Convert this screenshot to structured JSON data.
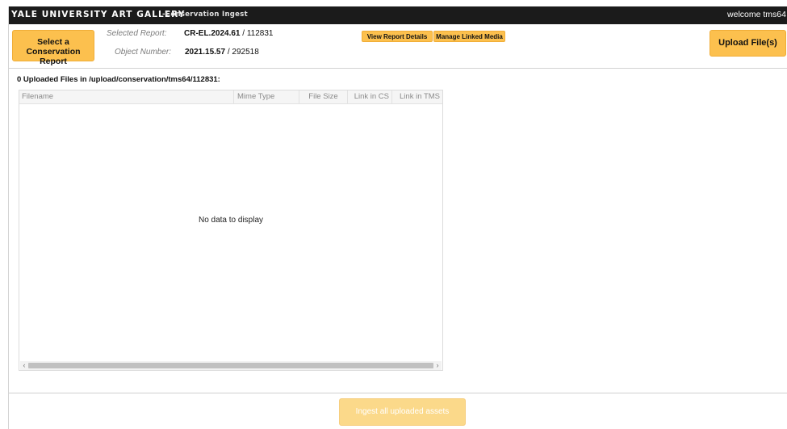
{
  "header": {
    "brand": "YALE UNIVERSITY ART GALLERY",
    "subtitle": "-Conservation Ingest",
    "welcome": "welcome tms64"
  },
  "toolbar": {
    "select_report_line1": "Select a",
    "select_report_line2": "Conservation Report",
    "view_report_details": "View Report Details",
    "manage_linked_media": "Manage Linked Media",
    "upload_files": "Upload File(s)"
  },
  "report": {
    "selected_label": "Selected Report:",
    "selected_id": "CR-EL.2024.61",
    "selected_suffix": " / 112831",
    "object_label": "Object Number:",
    "object_number": "2021.15.57",
    "object_suffix": " / 292518"
  },
  "files": {
    "heading": "0 Uploaded Files in /upload/conservation/tms64/112831:",
    "columns": {
      "filename": "Filename",
      "mime_type": "Mime Type",
      "file_size": "File Size",
      "link_cs": "Link in CS",
      "link_tms": "Link in TMS"
    },
    "empty_message": "No data to display",
    "rows": []
  },
  "footer": {
    "ingest_button": "Ingest all uploaded assets"
  },
  "colors": {
    "topbar": "#1b1b1b",
    "accent_button": "#fcc04e",
    "disabled_button": "#fbd98a"
  },
  "icons": {
    "scroll_left": "chevron-left-icon",
    "scroll_right": "chevron-right-icon"
  }
}
